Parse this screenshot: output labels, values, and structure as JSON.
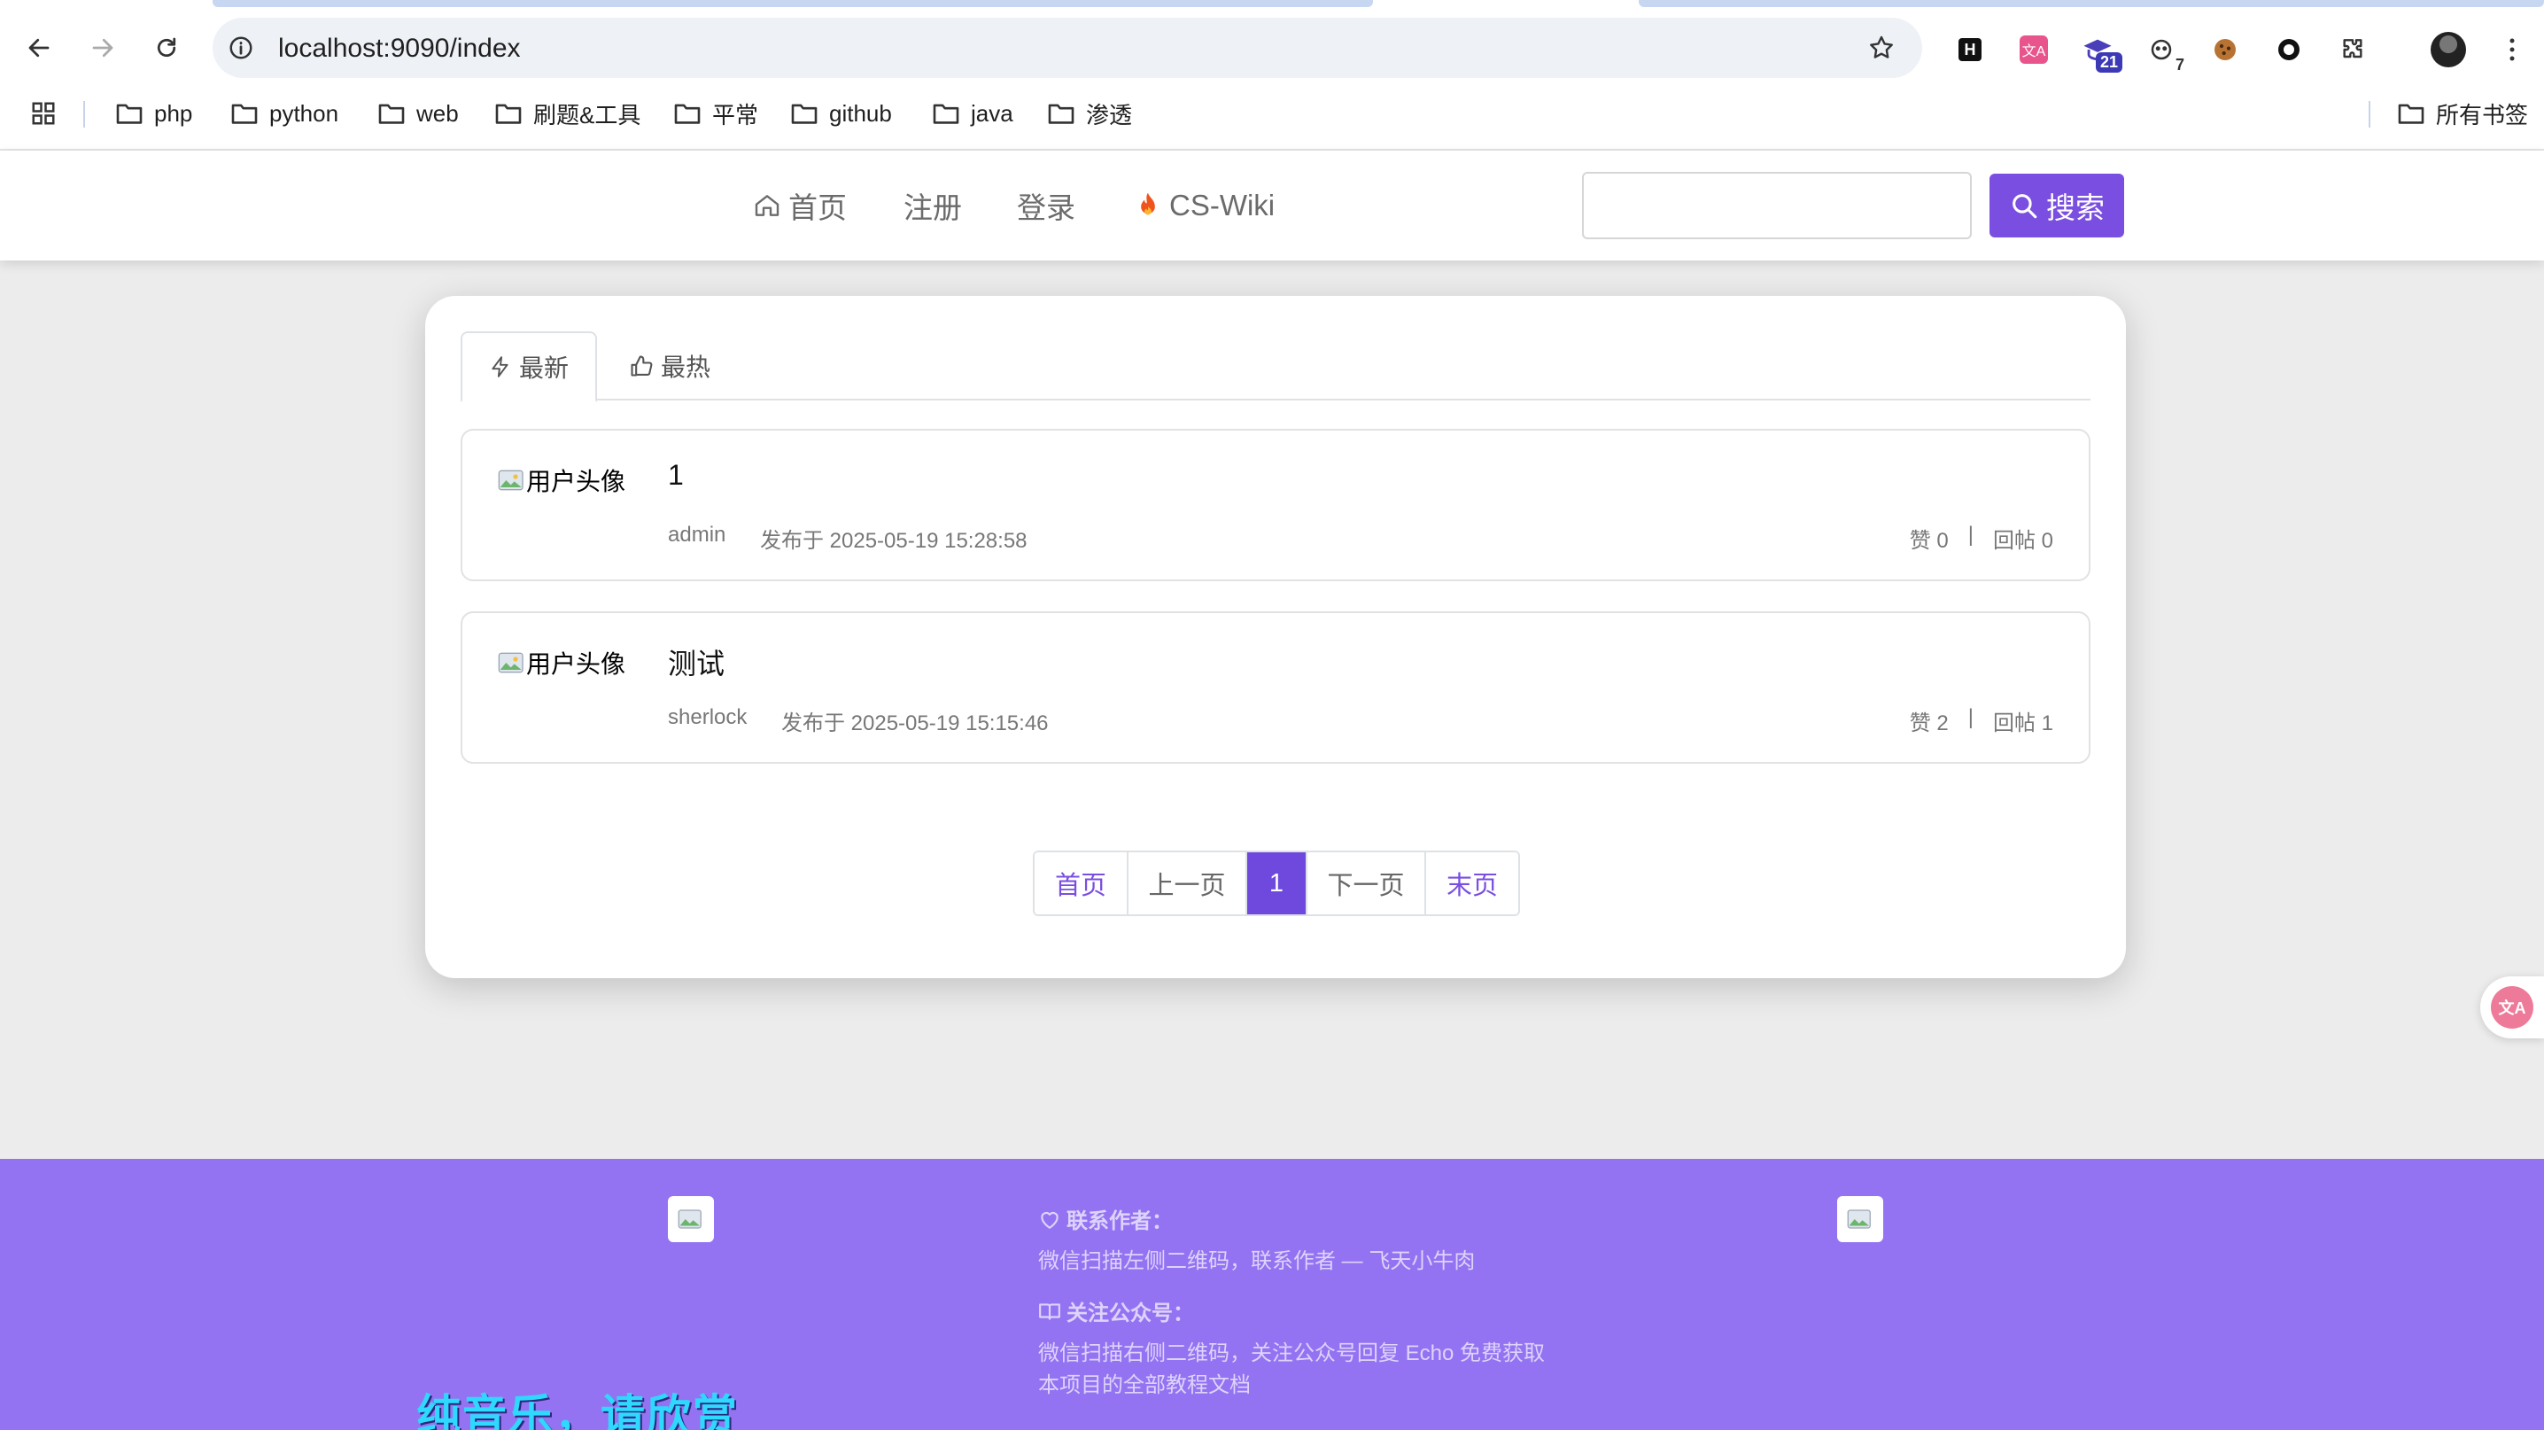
{
  "browser": {
    "url": "localhost:9090/index",
    "extensions": {
      "badge_21": "21",
      "badge_7": "7"
    },
    "bookmarks": [
      {
        "label": "php"
      },
      {
        "label": "python"
      },
      {
        "label": "web"
      },
      {
        "label": "刷题&工具"
      },
      {
        "label": "平常"
      },
      {
        "label": "github"
      },
      {
        "label": "java"
      },
      {
        "label": "渗透"
      }
    ],
    "all_bookmarks": "所有书签"
  },
  "header": {
    "nav": {
      "home": "首页",
      "register": "注册",
      "login": "登录",
      "wiki": "CS-Wiki"
    },
    "search_button": "搜索",
    "accent_color": "#7a4ee0"
  },
  "main": {
    "tabs": {
      "latest": "最新",
      "hottest": "最热"
    },
    "posts": [
      {
        "avatar_alt": "用户头像",
        "title": "1",
        "author": "admin",
        "published": "发布于 2025-05-19 15:28:58",
        "likes": "赞 0",
        "separator": "|",
        "replies": "回帖 0"
      },
      {
        "avatar_alt": "用户头像",
        "title": "测试",
        "author": "sherlock",
        "published": "发布于 2025-05-19 15:15:46",
        "likes": "赞 2",
        "separator": "|",
        "replies": "回帖 1"
      }
    ],
    "pagination": {
      "first": "首页",
      "prev": "上一页",
      "current": "1",
      "next": "下一页",
      "last": "末页"
    }
  },
  "footer": {
    "contact_title": "联系作者：",
    "contact_text": "微信扫描左侧二维码，联系作者 — 飞天小牛肉",
    "follow_title": "关注公众号：",
    "follow_text": "微信扫描右侧二维码，关注公众号回复 Echo 免费获取本项目的全部教程文档",
    "overlay_text": "纯音乐，请欣赏",
    "background_color": "#9473f2"
  }
}
